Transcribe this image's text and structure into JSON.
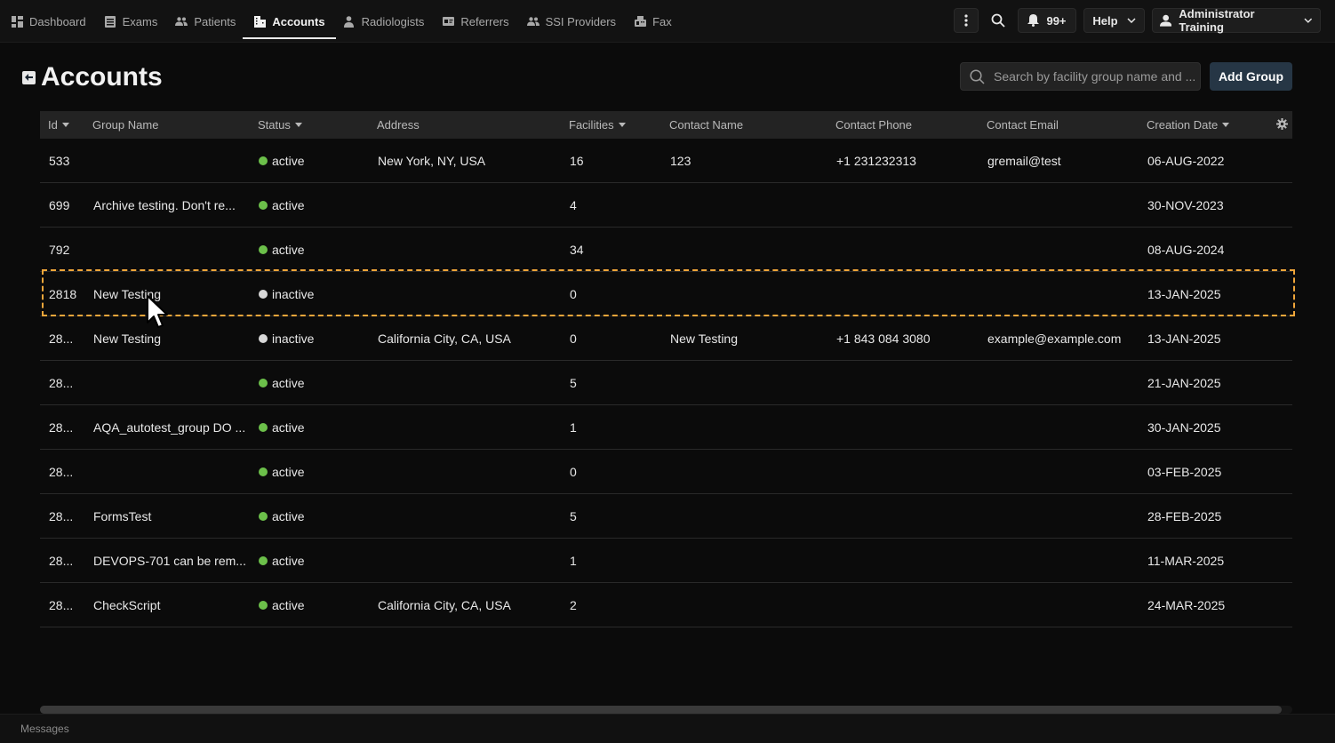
{
  "nav": {
    "items": [
      {
        "label": "Dashboard",
        "icon": "dashboard-icon",
        "active": false
      },
      {
        "label": "Exams",
        "icon": "list-icon",
        "active": false
      },
      {
        "label": "Patients",
        "icon": "people-icon",
        "active": false
      },
      {
        "label": "Accounts",
        "icon": "building-icon",
        "active": true
      },
      {
        "label": "Radiologists",
        "icon": "doctor-icon",
        "active": false
      },
      {
        "label": "Referrers",
        "icon": "id-card-icon",
        "active": false
      },
      {
        "label": "SSI Providers",
        "icon": "people-icon",
        "active": false
      },
      {
        "label": "Fax",
        "icon": "fax-icon",
        "active": false
      }
    ],
    "notifications_badge": "99+",
    "help_label": "Help",
    "user_label": "Administrator Training"
  },
  "page": {
    "title": "Accounts",
    "search_placeholder": "Search by facility group name and ...",
    "add_group_label": "Add Group"
  },
  "table": {
    "columns": [
      "Id",
      "Group Name",
      "Status",
      "Address",
      "Facilities",
      "Contact Name",
      "Contact Phone",
      "Contact Email",
      "Creation Date"
    ],
    "rows": [
      {
        "id": "533",
        "group": "",
        "status": "active",
        "address": "New York, NY, USA",
        "facilities": "16",
        "contact": "123",
        "phone": "+1 231232313",
        "email": "gremail@test",
        "date": "06-AUG-2022"
      },
      {
        "id": "699",
        "group": "Archive testing. Don't re...",
        "status": "active",
        "address": "",
        "facilities": "4",
        "contact": "",
        "phone": "",
        "email": "",
        "date": "30-NOV-2023"
      },
      {
        "id": "792",
        "group": "",
        "status": "active",
        "address": "",
        "facilities": "34",
        "contact": "",
        "phone": "",
        "email": "",
        "date": "08-AUG-2024"
      },
      {
        "id": "2818",
        "group": "New Testing",
        "status": "inactive",
        "address": "",
        "facilities": "0",
        "contact": "",
        "phone": "",
        "email": "",
        "date": "13-JAN-2025"
      },
      {
        "id": "28...",
        "group": "New Testing",
        "status": "inactive",
        "address": "California City, CA, USA",
        "facilities": "0",
        "contact": "New Testing",
        "phone": "+1 843 084 3080",
        "email": "example@example.com",
        "date": "13-JAN-2025"
      },
      {
        "id": "28...",
        "group": "",
        "status": "active",
        "address": "",
        "facilities": "5",
        "contact": "",
        "phone": "",
        "email": "",
        "date": "21-JAN-2025"
      },
      {
        "id": "28...",
        "group": "AQA_autotest_group DO ...",
        "status": "active",
        "address": "",
        "facilities": "1",
        "contact": "",
        "phone": "",
        "email": "",
        "date": "30-JAN-2025"
      },
      {
        "id": "28...",
        "group": "",
        "status": "active",
        "address": "",
        "facilities": "0",
        "contact": "",
        "phone": "",
        "email": "",
        "date": "03-FEB-2025"
      },
      {
        "id": "28...",
        "group": "FormsTest",
        "status": "active",
        "address": "",
        "facilities": "5",
        "contact": "",
        "phone": "",
        "email": "",
        "date": "28-FEB-2025"
      },
      {
        "id": "28...",
        "group": "DEVOPS-701 can be rem...",
        "status": "active",
        "address": "",
        "facilities": "1",
        "contact": "",
        "phone": "",
        "email": "",
        "date": "11-MAR-2025"
      },
      {
        "id": "28...",
        "group": "CheckScript",
        "status": "active",
        "address": "California City, CA, USA",
        "facilities": "2",
        "contact": "",
        "phone": "",
        "email": "",
        "date": "24-MAR-2025"
      }
    ]
  },
  "footer": {
    "messages_label": "Messages"
  },
  "colors": {
    "active": "#6cc04a",
    "inactive": "#d8d8d8",
    "selection": "#f0a63a",
    "accent_button": "#263645"
  }
}
